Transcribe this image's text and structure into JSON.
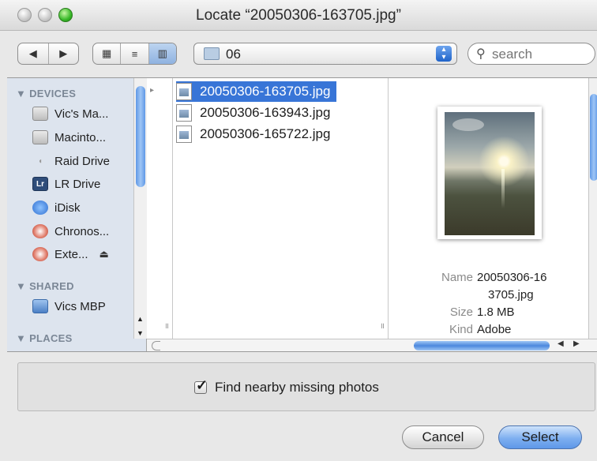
{
  "window": {
    "title": "Locate “20050306-163705.jpg”"
  },
  "toolbar": {
    "back_glyph": "◀",
    "forward_glyph": "▶",
    "view_icon_glyph": "▦",
    "view_list_glyph": "≡",
    "view_column_glyph": "▥",
    "folder_label": "06",
    "search_placeholder": "search"
  },
  "sidebar": {
    "devices_heading": "▼ DEVICES",
    "devices": [
      {
        "label": "Vic's Ma...",
        "icon": "hard-drive-icon"
      },
      {
        "label": "Macinto...",
        "icon": "hard-drive-icon"
      },
      {
        "label": "Raid Drive",
        "icon": "raid-icon"
      },
      {
        "label": "LR Drive",
        "icon": "lr-drive-icon"
      },
      {
        "label": "iDisk",
        "icon": "idisk-icon"
      },
      {
        "label": "Chronos...",
        "icon": "time-machine-icon"
      },
      {
        "label": "Exte...",
        "icon": "time-machine-icon",
        "eject": "⏏"
      }
    ],
    "shared_heading": "▼ SHARED",
    "shared": [
      {
        "label": "Vics MBP",
        "icon": "network-computer-icon"
      }
    ],
    "places_heading": "▼ PLACES"
  },
  "files": [
    {
      "name": "20050306-163705.jpg",
      "selected": true
    },
    {
      "name": "20050306-163943.jpg",
      "selected": false
    },
    {
      "name": "20050306-165722.jpg",
      "selected": false
    }
  ],
  "preview": {
    "name_label": "Name",
    "name_value_1": "20050306-16",
    "name_value_2": "3705.jpg",
    "size_label": "Size",
    "size_value": "1.8 MB",
    "kind_label": "Kind",
    "kind_value": "Adobe"
  },
  "options": {
    "find_nearby_label": "Find nearby missing photos",
    "checked": true
  },
  "buttons": {
    "cancel": "Cancel",
    "select": "Select"
  },
  "colors": {
    "selection": "#3875d7",
    "sidebar_bg": "#dde4ee",
    "accent_button": "#6aa2ee"
  }
}
